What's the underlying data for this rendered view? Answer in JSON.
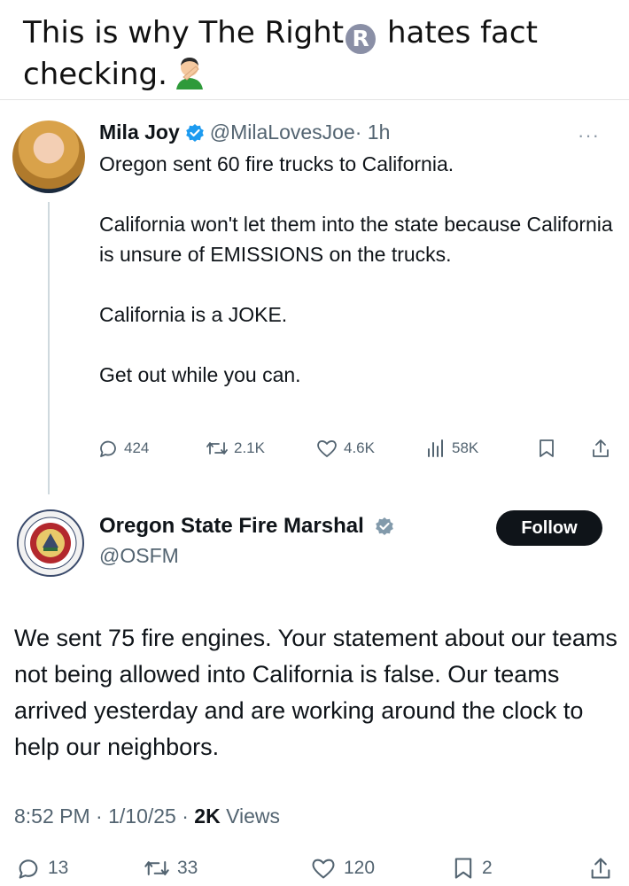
{
  "caption": {
    "line1_pre": "This is why The Right",
    "reg_symbol": "R",
    "line1_post": "hates fact",
    "line2": "checking.",
    "emoji_icon": "person-facepalming-icon"
  },
  "tweet": {
    "author_name": "Mila Joy",
    "handle": "@MilaLovesJoe",
    "time": "· 1h",
    "more": "···",
    "paragraphs": [
      "Oregon sent 60 fire trucks to California.",
      "California won't let them into the state because California is unsure of EMISSIONS on the trucks.",
      "California is a JOKE.",
      "Get out while you can."
    ],
    "stats": {
      "replies": "424",
      "reposts": "2.1K",
      "likes": "4.6K",
      "views": "58K"
    }
  },
  "reply": {
    "author_name": "Oregon State Fire Marshal",
    "handle": "@OSFM",
    "follow_label": "Follow",
    "body": "We sent 75 fire engines. Your statement about our teams not being allowed into California is false. Our teams arrived yesterday and are working around the clock to help our neighbors.",
    "time": "8:52 PM · 1/10/25 · ",
    "views_count": "2K",
    "views_label": " Views",
    "stats": {
      "replies": "13",
      "reposts": "33",
      "likes": "120",
      "bookmarks": "2"
    }
  },
  "colors": {
    "text": "#0f1419",
    "secondary": "#536471",
    "verified_blue": "#1d9bf0",
    "verified_gray": "#829aab",
    "follow_bg": "#0f1419"
  }
}
